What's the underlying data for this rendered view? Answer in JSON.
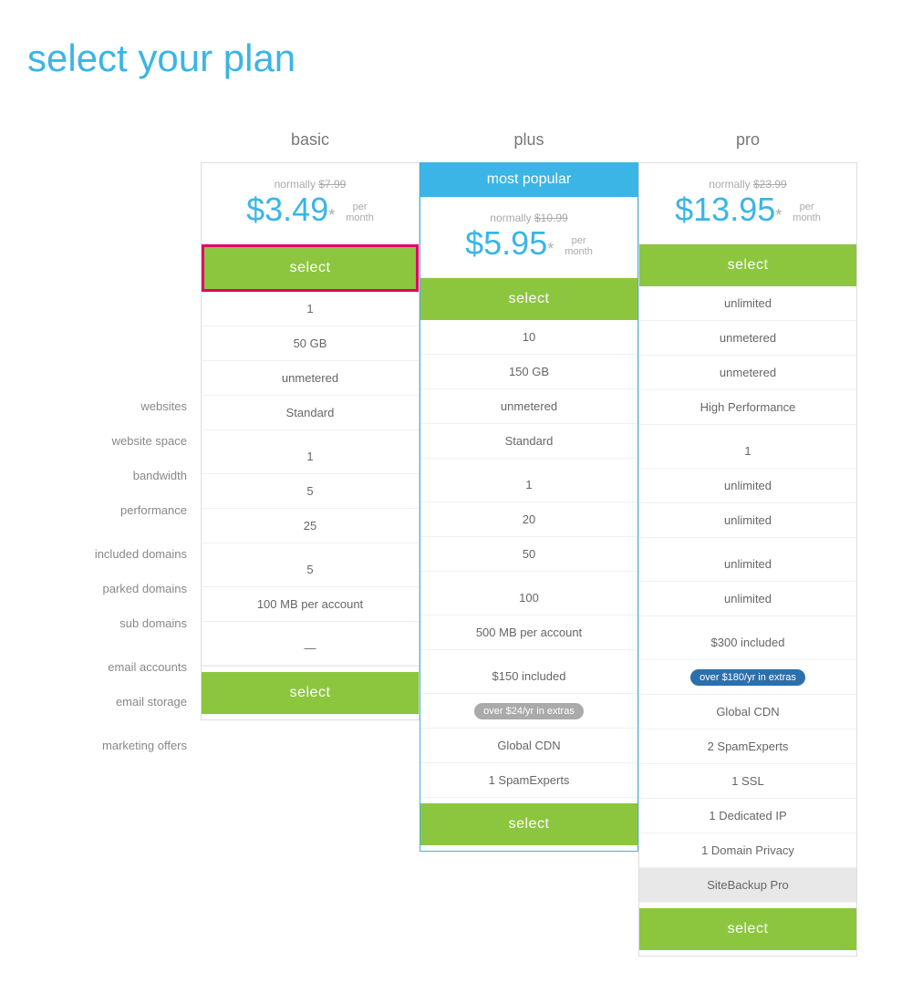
{
  "page": {
    "title": "select your plan"
  },
  "labels": {
    "websites": "websites",
    "website_space": "website space",
    "bandwidth": "bandwidth",
    "performance": "performance",
    "included_domains": "included domains",
    "parked_domains": "parked domains",
    "sub_domains": "sub domains",
    "email_accounts": "email accounts",
    "email_storage": "email storage",
    "marketing_offers": "marketing offers"
  },
  "plans": {
    "basic": {
      "name": "basic",
      "badge": "",
      "normally_label": "normally",
      "original_price": "$7.99",
      "price": "$3.49",
      "asterisk": "*",
      "per": "per",
      "month": "month",
      "select_label": "select",
      "features": {
        "websites": "1",
        "website_space": "50 GB",
        "bandwidth": "unmetered",
        "performance": "Standard",
        "included_domains": "1",
        "parked_domains": "5",
        "sub_domains": "25",
        "email_accounts": "5",
        "email_storage": "100 MB per account",
        "marketing_offers": "—"
      }
    },
    "plus": {
      "name": "plus",
      "badge": "most popular",
      "normally_label": "normally",
      "original_price": "$10.99",
      "price": "$5.95",
      "asterisk": "*",
      "per": "per",
      "month": "month",
      "select_label": "select",
      "features": {
        "websites": "10",
        "website_space": "150 GB",
        "bandwidth": "unmetered",
        "performance": "Standard",
        "included_domains": "1",
        "parked_domains": "20",
        "sub_domains": "50",
        "email_accounts": "100",
        "email_storage": "500 MB per account",
        "marketing_offers": "$150 included"
      },
      "extras_badge": "over $24/yr in extras",
      "extras": [
        "Global CDN",
        "1 SpamExperts"
      ]
    },
    "pro": {
      "name": "pro",
      "badge": "",
      "normally_label": "normally",
      "original_price": "$23.99",
      "price": "$13.95",
      "asterisk": "*",
      "per": "per",
      "month": "month",
      "select_label": "select",
      "features": {
        "websites": "unlimited",
        "website_space": "unmetered",
        "bandwidth": "unmetered",
        "performance": "High Performance",
        "included_domains": "1",
        "parked_domains": "unlimited",
        "sub_domains": "unlimited",
        "email_accounts": "unlimited",
        "email_storage": "unlimited",
        "marketing_offers": "$300 included"
      },
      "extras_badge": "over $180/yr in extras",
      "extras": [
        "Global CDN",
        "2 SpamExperts",
        "1 SSL",
        "1 Dedicated IP",
        "1 Domain Privacy",
        "SiteBackup Pro"
      ]
    }
  }
}
